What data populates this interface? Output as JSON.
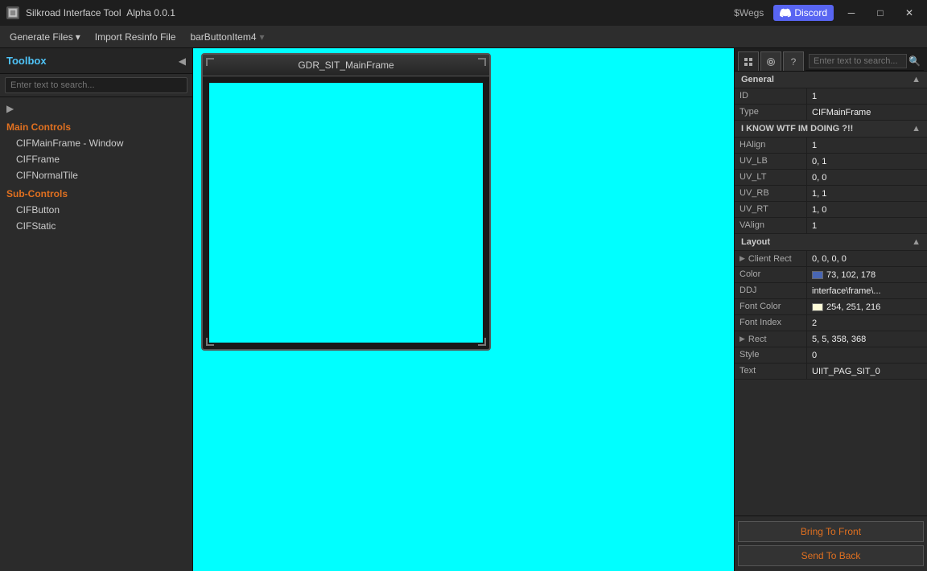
{
  "titlebar": {
    "app_name": "Silkroad Interface Tool",
    "version": "Alpha 0.0.1",
    "minimize": "─",
    "maximize": "□",
    "close": "✕",
    "discord_label": "Discord",
    "wegs_label": "$Wegs"
  },
  "menubar": {
    "items": [
      {
        "label": "Generate Files",
        "has_dropdown": true
      },
      {
        "label": "Import Resinfo File"
      },
      {
        "label": "barButtonItem4"
      }
    ]
  },
  "toolbox": {
    "title": "Toolbox",
    "search_placeholder": "Enter text to search...",
    "collapse_label": "◀",
    "tree_toggle": "▶",
    "main_controls_label": "Main Controls",
    "main_controls_items": [
      "CIFMainFrame - Window",
      "CIFFrame",
      "CIFNormalTile"
    ],
    "sub_controls_label": "Sub-Controls",
    "sub_controls_items": [
      "CIFButton",
      "CIFStatic"
    ]
  },
  "canvas": {
    "frame_title": "GDR_SIT_MainFrame",
    "background_color": "#00ffff"
  },
  "right_panel": {
    "search_placeholder": "Enter text to search...",
    "tabs": [
      "grid-icon",
      "gear-icon",
      "help-icon"
    ],
    "sections": {
      "general": {
        "label": "General",
        "properties": [
          {
            "name": "ID",
            "value": "1"
          },
          {
            "name": "Type",
            "value": "CIFMainFrame"
          }
        ]
      },
      "i_know": {
        "label": "I KNOW WTF IM DOING ?!!",
        "properties": [
          {
            "name": "HAlign",
            "value": "1"
          },
          {
            "name": "UV_LB",
            "value": "0, 1"
          },
          {
            "name": "UV_LT",
            "value": "0, 0"
          },
          {
            "name": "UV_RB",
            "value": "1, 1"
          },
          {
            "name": "UV_RT",
            "value": "1, 0"
          },
          {
            "name": "VAlign",
            "value": "1"
          }
        ]
      },
      "layout": {
        "label": "Layout",
        "properties": [
          {
            "name": "Client Rect",
            "value": "0, 0, 0, 0",
            "expandable": true
          },
          {
            "name": "Color",
            "value": "73, 102, 178",
            "color": "#4966b2"
          },
          {
            "name": "DDJ",
            "value": "interface\\frame\\..."
          },
          {
            "name": "Font Color",
            "value": "254, 251, 216",
            "color": "#fefbd8"
          },
          {
            "name": "Font Index",
            "value": "2"
          },
          {
            "name": "Rect",
            "value": "5, 5, 358, 368",
            "expandable": true
          },
          {
            "name": "Style",
            "value": "0"
          },
          {
            "name": "Text",
            "value": "UIIT_PAG_SIT_0"
          }
        ]
      }
    },
    "buttons": {
      "bring_to_front": "Bring To Front",
      "send_to_back": "Send To Back"
    }
  }
}
